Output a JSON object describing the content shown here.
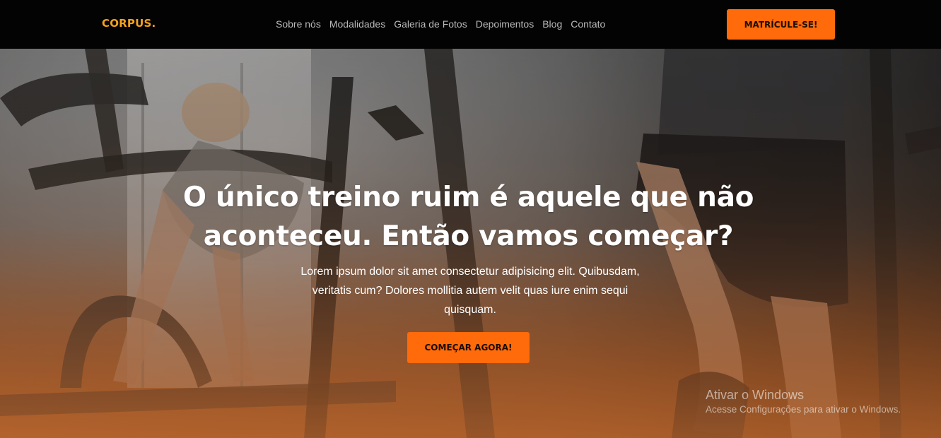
{
  "header": {
    "logo": {
      "brand": "CORPUS",
      "dot": "."
    },
    "nav": [
      "Sobre nós",
      "Modalidades",
      "Galeria de Fotos",
      "Depoimentos",
      "Blog",
      "Contato"
    ],
    "cta_label": "MATRÍCULE-SE!"
  },
  "hero": {
    "title": "O único treino ruim é aquele que não aconteceu. Então vamos começar?",
    "text": "Lorem ipsum dolor sit amet consectetur adipisicing elit. Quibusdam, veritatis cum? Dolores mollitia autem velit quas iure enim sequi quisquam.",
    "cta_label": "COMEÇAR AGORA!",
    "background": "gym-treadmill-photo"
  },
  "watermark": {
    "title": "Ativar o Windows",
    "subtitle": "Acesse Configurações para ativar o Windows."
  },
  "colors": {
    "accent": "#ff6a0a",
    "logo": "#f6a21c",
    "header_bg": "#030303"
  }
}
